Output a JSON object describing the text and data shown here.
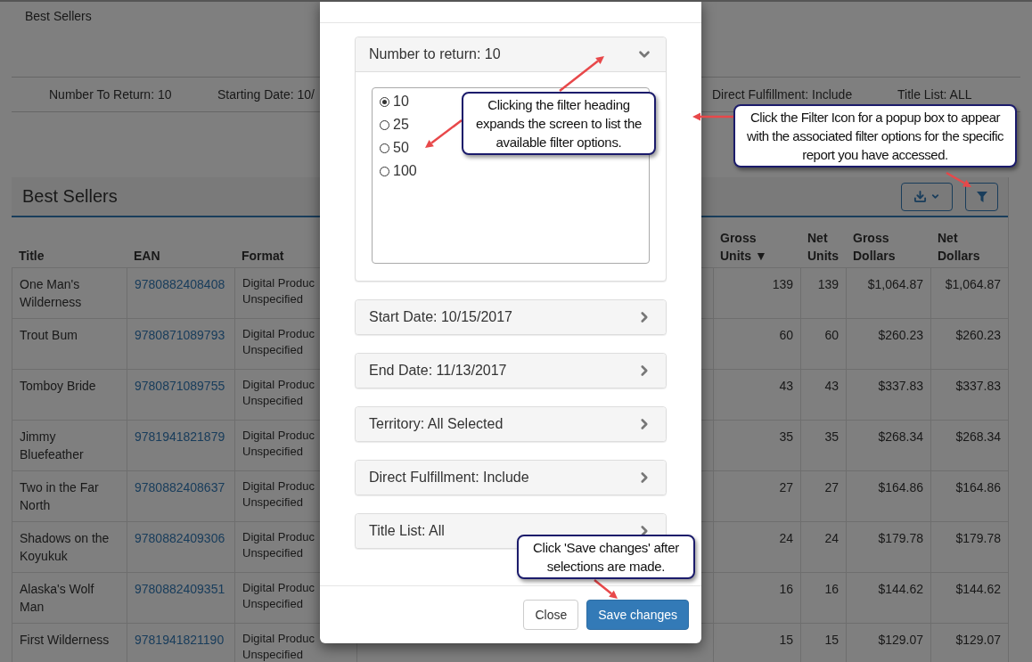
{
  "page_title": "Best Sellers",
  "filter_summary": [
    "Number To Return: 10",
    "Starting Date: 10/",
    "Direct Fulfillment: Include",
    "Title List: ALL"
  ],
  "report": {
    "title": "Best Sellers",
    "columns": [
      "Title",
      "EAN",
      "Format",
      "Gross Units ▼",
      "Net Units",
      "Gross Dollars",
      "Net Dollars"
    ],
    "rows": [
      {
        "title": "One Man's Wilderness",
        "ean": "9780882408408",
        "format": "Digital Produc Unspecified",
        "gross_units": "139",
        "net_units": "139",
        "gross_dollars": "$1,064.87",
        "net_dollars": "$1,064.87"
      },
      {
        "title": "Trout Bum",
        "ean": "9780871089793",
        "format": "Digital Produc Unspecified",
        "gross_units": "60",
        "net_units": "60",
        "gross_dollars": "$260.23",
        "net_dollars": "$260.23"
      },
      {
        "title": "Tomboy Bride",
        "ean": "9780871089755",
        "format": "Digital Produc Unspecified",
        "gross_units": "43",
        "net_units": "43",
        "gross_dollars": "$337.83",
        "net_dollars": "$337.83"
      },
      {
        "title": "Jimmy Bluefeather",
        "ean": "9781941821879",
        "format": "Digital Produc Unspecified",
        "gross_units": "35",
        "net_units": "35",
        "gross_dollars": "$268.34",
        "net_dollars": "$268.34"
      },
      {
        "title": "Two in the Far North",
        "ean": "9780882408637",
        "format": "Digital Produc Unspecified",
        "gross_units": "27",
        "net_units": "27",
        "gross_dollars": "$164.86",
        "net_dollars": "$164.86"
      },
      {
        "title": "Shadows on the Koyukuk",
        "ean": "9780882409306",
        "format": "Digital Produc Unspecified",
        "gross_units": "24",
        "net_units": "24",
        "gross_dollars": "$179.78",
        "net_dollars": "$179.78"
      },
      {
        "title": "Alaska's Wolf Man",
        "ean": "9780882409351",
        "format": "Digital Produc Unspecified",
        "gross_units": "16",
        "net_units": "16",
        "gross_dollars": "$144.62",
        "net_dollars": "$144.62"
      },
      {
        "title": "First Wilderness",
        "ean": "9781941821190",
        "format": "Digital Produc Unspecified",
        "gross_units": "15",
        "net_units": "15",
        "gross_dollars": "$129.07",
        "net_dollars": "$129.07"
      }
    ]
  },
  "modal": {
    "filters": [
      {
        "label": "Number to return: 10",
        "expanded": true,
        "options": [
          {
            "label": "10",
            "selected": true
          },
          {
            "label": "25",
            "selected": false
          },
          {
            "label": "50",
            "selected": false
          },
          {
            "label": "100",
            "selected": false
          }
        ]
      },
      {
        "label": "Start Date: 10/15/2017",
        "expanded": false
      },
      {
        "label": "End Date: 11/13/2017",
        "expanded": false
      },
      {
        "label": "Territory: All Selected",
        "expanded": false
      },
      {
        "label": "Direct Fulfillment: Include",
        "expanded": false
      },
      {
        "label": "Title List: All",
        "expanded": false
      }
    ],
    "buttons": [
      {
        "label": "Close",
        "kind": "default"
      },
      {
        "label": "Save changes",
        "kind": "primary"
      }
    ]
  },
  "annotations": [
    {
      "text": "Clicking the filter heading expands the screen to list the available filter options."
    },
    {
      "text": "Click the Filter Icon for a popup box to appear with the associated filter options for the specific report you have accessed."
    },
    {
      "text": "Click 'Save changes' after selections are made."
    }
  ]
}
